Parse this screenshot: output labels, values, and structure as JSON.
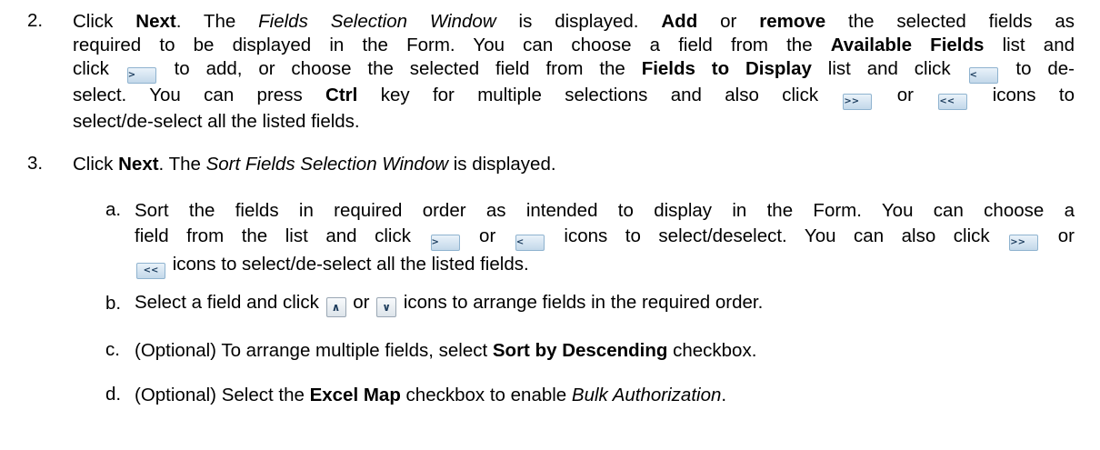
{
  "icons": {
    "add": ">",
    "remove": "<",
    "add_all": ">>",
    "remove_all": "<<",
    "move_up": "∧",
    "move_down": "∨"
  },
  "step2": {
    "number": "2.",
    "t1": "Click ",
    "b1": "Next",
    "t2": ". The ",
    "i1": "Fields Selection Window",
    "t3": " is displayed. ",
    "b2": "Add",
    "t4": " or ",
    "b3": "remove",
    "t5": " the selected fields as",
    "t6": "required to be displayed in the Form. You can choose a field from the ",
    "b4": "Available Fields",
    "t7": " list and",
    "t8": "click ",
    "t9": " to add, or choose the selected field from the ",
    "b5": "Fields to Display",
    "t10": " list and click ",
    "t11": " to de-",
    "t12": "select. You can press ",
    "b6": "Ctrl",
    "t13": " key for multiple selections and also click ",
    "t14": " or ",
    "t15": " icons to",
    "t16": "select/de-select all the listed fields."
  },
  "step3": {
    "number": "3.",
    "t1": "Click ",
    "b1": "Next",
    "t2": ". The ",
    "i1": "Sort Fields Selection Window",
    "t3": " is displayed."
  },
  "sub_a": {
    "letter": "a.",
    "t1": "Sort the fields in required order as intended to display in the Form. You can choose a",
    "t2": "field from the list and click ",
    "t3": " or ",
    "t4": " icons to select/deselect. You can also click ",
    "t5": " or",
    "t6": " icons to select/de-select all the listed fields."
  },
  "sub_b": {
    "letter": "b.",
    "t1": "Select a field and click ",
    "t2": " or ",
    "t3": " icons to arrange fields in the required order."
  },
  "sub_c": {
    "letter": "c.",
    "t1": "(Optional) To arrange multiple fields, select ",
    "b1": "Sort by Descending",
    "t2": " checkbox."
  },
  "sub_d": {
    "letter": "d.",
    "t1": "(Optional) Select the ",
    "b1": "Excel Map",
    "t2": " checkbox to enable ",
    "i1": "Bulk Authorization",
    "t3": "."
  }
}
